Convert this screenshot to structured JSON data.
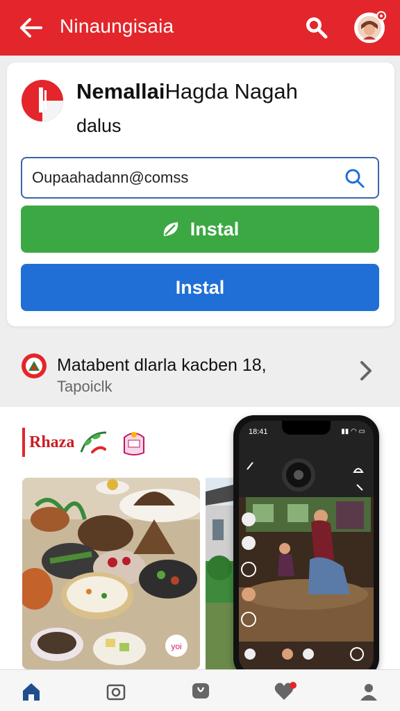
{
  "topbar": {
    "title": "Ninaungisaia",
    "back_icon": "arrow-left-icon",
    "search_icon": "search-icon",
    "profile_icon": "avatar-icon",
    "color": "#e3262b"
  },
  "app": {
    "name_bold": "Nemallai",
    "name_rest": "Hagda Nagah",
    "subtitle": "dalus",
    "search_value": "Oupaahadann@comss",
    "install_green_label": "Instal",
    "install_blue_label": "Instal",
    "green_color": "#3ca844",
    "blue_color": "#1f6fd6"
  },
  "promo": {
    "title": "Matabent dlarla kacben 18,",
    "subtitle": "Tapoiclk",
    "chevron_icon": "chevron-right-icon"
  },
  "content": {
    "brand_text": "Rhaza",
    "phone_time": "18:41",
    "food_badge": "yoi"
  },
  "bottomnav": {
    "items": [
      "home-icon",
      "camera-icon",
      "chat-icon",
      "heart-icon",
      "profile-icon"
    ]
  }
}
